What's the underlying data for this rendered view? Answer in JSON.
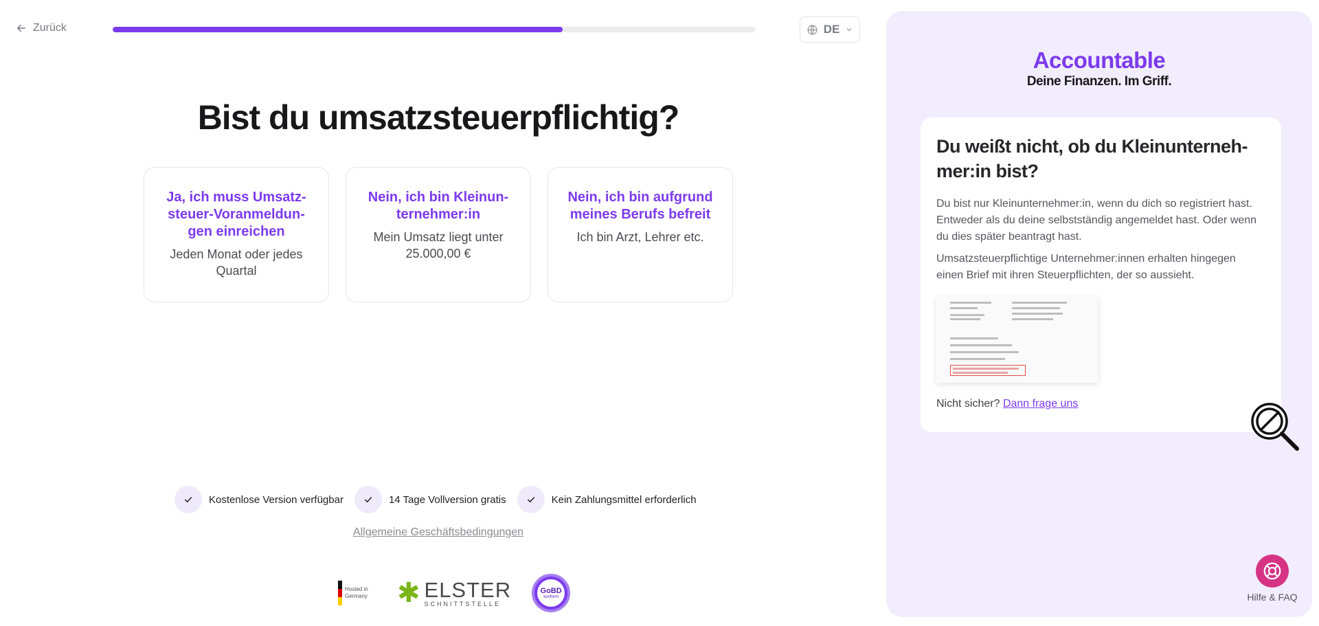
{
  "nav": {
    "back_label": "Zurück",
    "progress_percent": 70,
    "language": "DE"
  },
  "question": "Bist du umsatzsteuerpflichtig?",
  "options": [
    {
      "title": "Ja, ich muss Umsatz-steuer-Voranmeldun-gen einreichen",
      "subtitle": "Jeden Monat oder jedes Quartal"
    },
    {
      "title": "Nein, ich bin Kleinun-ternehmer:in",
      "subtitle": "Mein Umsatz liegt unter 25.000,00 €"
    },
    {
      "title": "Nein, ich bin aufgrund meines Berufs befreit",
      "subtitle": "Ich bin Arzt, Lehrer etc."
    }
  ],
  "perks": [
    "Kostenlose Version verfügbar",
    "14 Tage Vollversion gratis",
    "Kein Zahlungsmittel erforderlich"
  ],
  "terms_link": "Allgemeine Geschäftsbedingungen",
  "badges": {
    "hosted": "Hosted in Germany",
    "elster_main": "ELSTER",
    "elster_sub": "SCHNITTSTELLE",
    "gobd_main": "GoBD",
    "gobd_sub": "konform"
  },
  "brand": {
    "name": "Accountable",
    "tagline": "Deine Finanzen. Im Griff."
  },
  "info": {
    "title": "Du weißt nicht, ob du Kleinunterneh-mer:in bist?",
    "paragraph1": "Du bist nur Kleinunternehmer:in, wenn du dich so registriert hast. Entweder als du deine selbstständig angemeldet hast. Oder wenn du dies später beantragt hast.",
    "paragraph2": "Umsatzsteuerpflichtige Unternehmer:innen erhalten hingegen einen Brief mit ihren Steuerpflichten, der so aussieht.",
    "unsure_text": "Nicht sicher?",
    "ask_link": "Dann frage uns"
  },
  "help": {
    "label": "Hilfe & FAQ"
  },
  "colors": {
    "accent": "#7c3aed",
    "panel_bg": "#f1edfc",
    "help_button": "#d63384"
  }
}
